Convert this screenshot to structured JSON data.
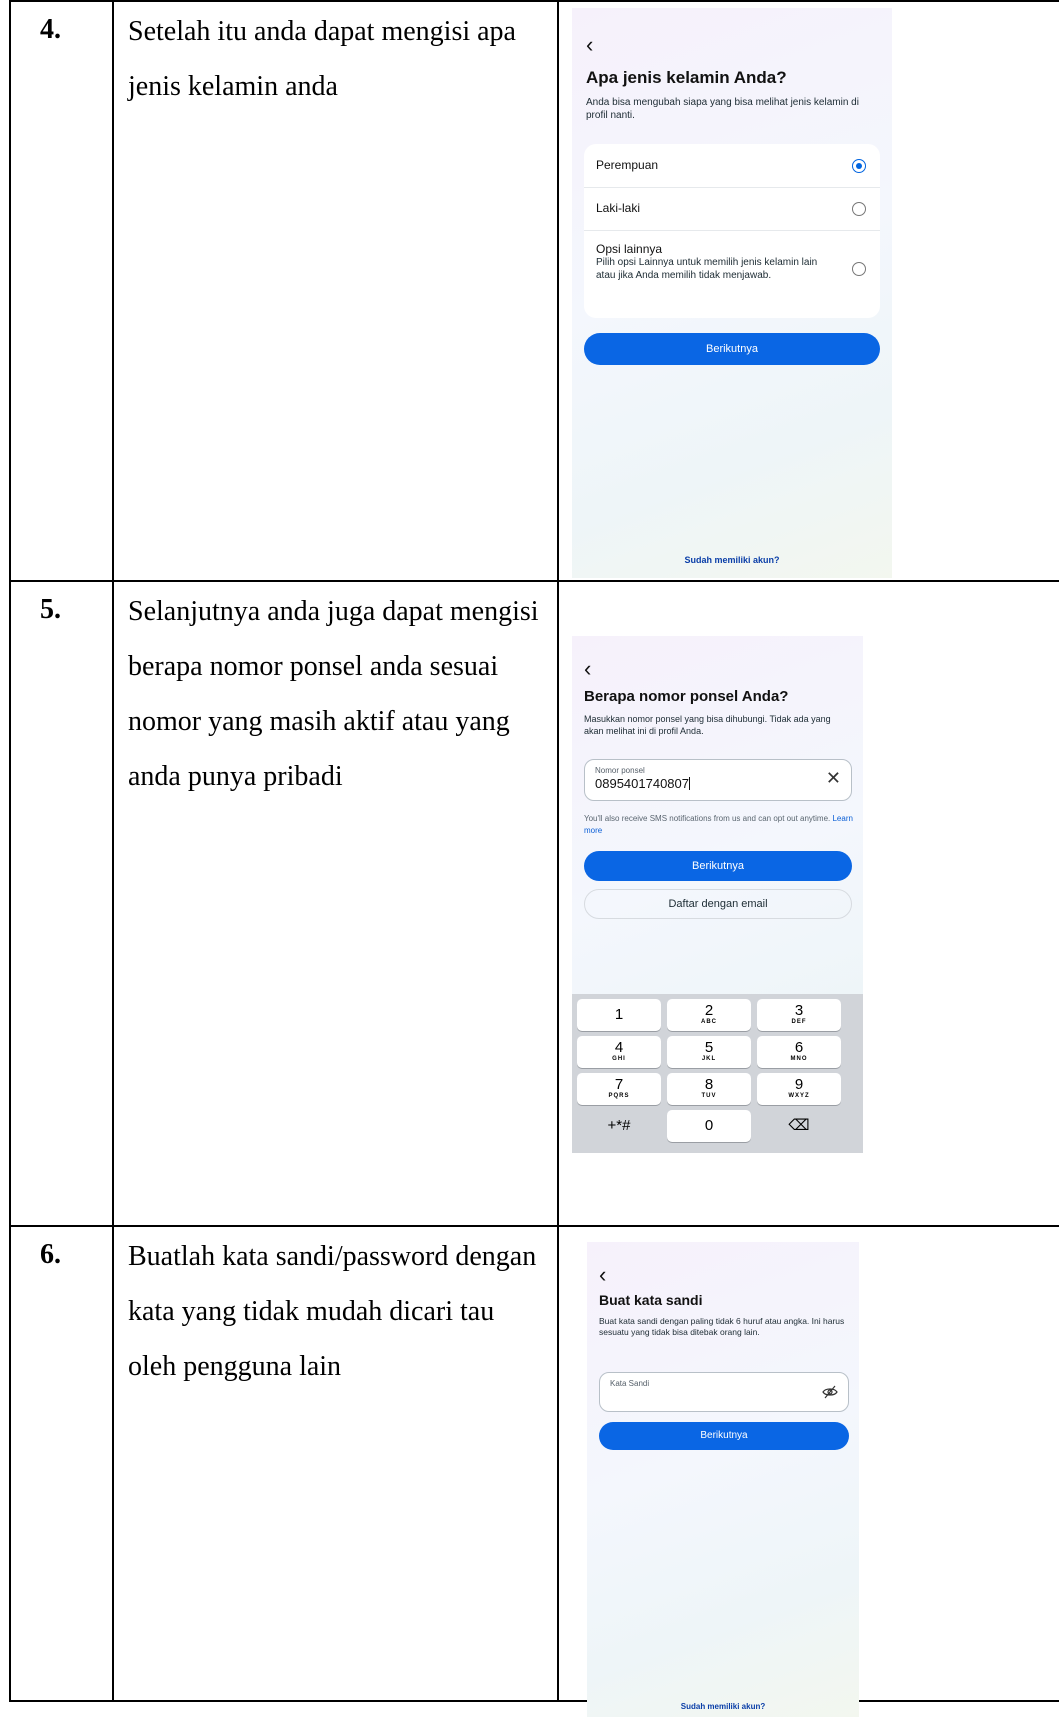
{
  "rows": [
    {
      "number": "4.",
      "text": "Setelah itu anda dapat mengisi apa jenis kelamin anda",
      "screen": {
        "back_icon": "chevron-left-icon",
        "title": "Apa jenis kelamin Anda?",
        "subtitle": "Anda bisa mengubah siapa yang bisa melihat jenis kelamin di profil nanti.",
        "options": [
          {
            "label": "Perempuan",
            "selected": true
          },
          {
            "label": "Laki-laki",
            "selected": false
          },
          {
            "label": "Opsi lainnya",
            "desc": "Pilih opsi Lainnya untuk memilih jenis kelamin lain atau jika Anda memilih tidak menjawab.",
            "selected": false
          }
        ],
        "next_button": "Berikutnya",
        "login_link": "Sudah memiliki akun?"
      }
    },
    {
      "number": "5.",
      "text": "Selanjutnya anda juga dapat mengisi berapa nomor ponsel anda sesuai nomor yang masih aktif atau yang anda punya pribadi",
      "screen": {
        "back_icon": "chevron-left-icon",
        "title": "Berapa nomor ponsel Anda?",
        "subtitle": "Masukkan nomor ponsel yang bisa dihubungi. Tidak ada yang akan melihat ini di profil Anda.",
        "input_label": "Nomor ponsel",
        "input_value": "0895401740807",
        "clear_icon": "close-icon",
        "sms_note": "You'll also receive SMS notifications from us and can opt out anytime.",
        "learn_more": "Learn more",
        "next_button": "Berikutnya",
        "email_button": "Daftar dengan email",
        "keypad": [
          {
            "d": "1",
            "l": ""
          },
          {
            "d": "2",
            "l": "ABC"
          },
          {
            "d": "3",
            "l": "DEF"
          },
          {
            "d": "4",
            "l": "GHI"
          },
          {
            "d": "5",
            "l": "JKL"
          },
          {
            "d": "6",
            "l": "MNO"
          },
          {
            "d": "7",
            "l": "PQRS"
          },
          {
            "d": "8",
            "l": "TUV"
          },
          {
            "d": "9",
            "l": "WXYZ"
          },
          {
            "d": "+*#",
            "l": ""
          },
          {
            "d": "0",
            "l": ""
          },
          {
            "d": "⌫",
            "l": ""
          }
        ]
      }
    },
    {
      "number": "6.",
      "text": "Buatlah kata sandi/password dengan kata yang tidak mudah dicari tau oleh pengguna lain",
      "screen": {
        "back_icon": "chevron-left-icon",
        "title": "Buat kata sandi",
        "subtitle": "Buat kata sandi dengan paling tidak 6 huruf atau angka. Ini harus sesuatu yang tidak bisa ditebak orang lain.",
        "input_label": "Kata Sandi",
        "eye_icon": "eye-off-icon",
        "next_button": "Berikutnya",
        "login_link": "Sudah memiliki akun?"
      }
    }
  ]
}
